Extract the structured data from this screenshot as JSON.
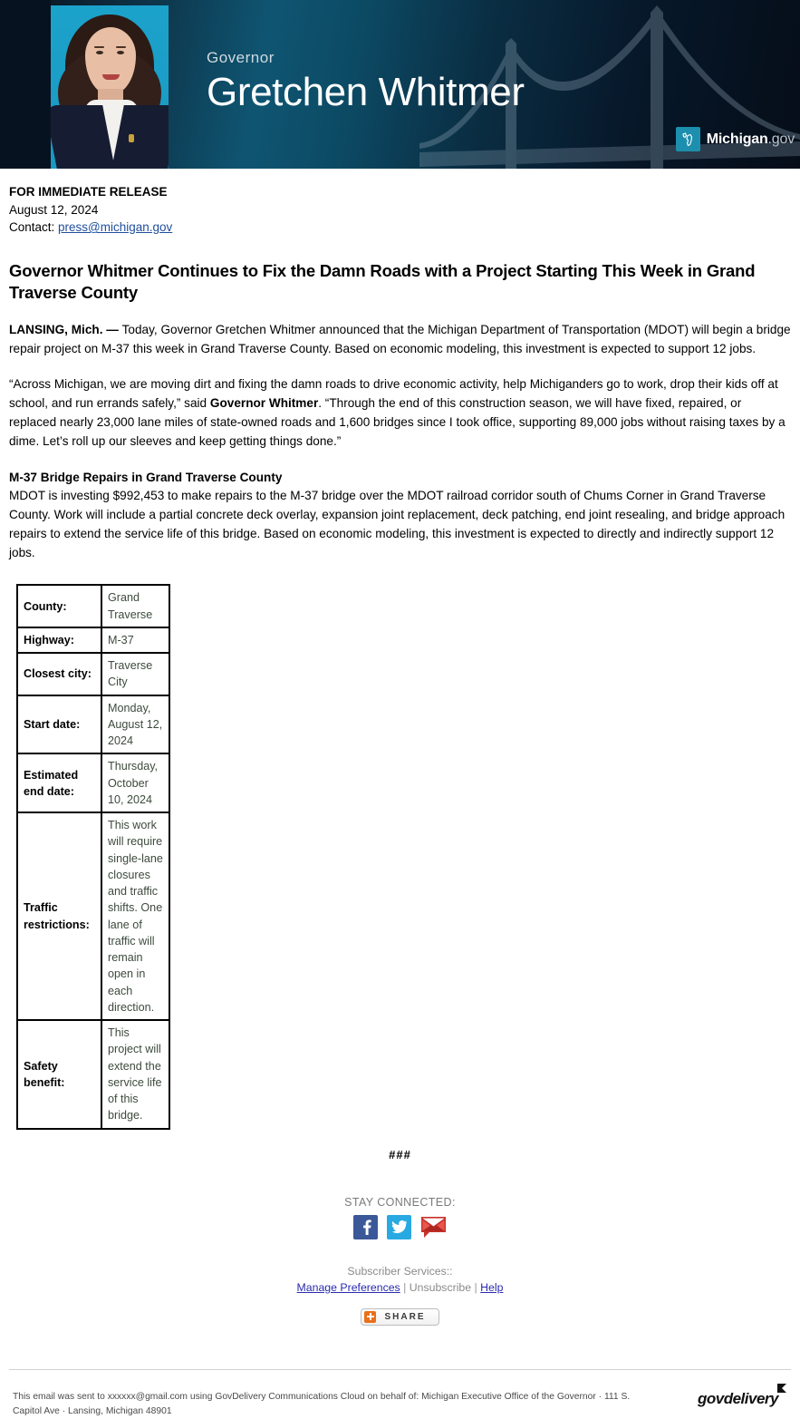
{
  "banner": {
    "gov_label": "Governor",
    "gov_name": "Gretchen Whitmer",
    "logo_word": "Michigan",
    "logo_suffix": ".gov",
    "portrait_alt": "governor-portrait",
    "gradient_start": "#0f5572",
    "gradient_end": "#050d18",
    "badge_color": "#1d8fae"
  },
  "release": {
    "label": "FOR IMMEDIATE RELEASE",
    "date": "August 12, 2024",
    "contact_prefix": "Contact: ",
    "contact_email": "press@michigan.gov"
  },
  "headline": "Governor Whitmer Continues to Fix the Damn Roads with a Project Starting This Week in Grand Traverse County",
  "paragraphs": {
    "lede_dateline": "LANSING, Mich. — ",
    "lede_body": " Today, Governor Gretchen Whitmer announced that the Michigan Department of Transportation (MDOT) will begin a bridge repair project on M-37 this week in Grand Traverse County. Based on economic modeling, this investment is expected to support 12 jobs.",
    "quote_part1": "“Across Michigan, we are moving dirt and fixing the damn roads to drive economic activity, help Michiganders go to work, drop their kids off at school, and run errands safely,” said ",
    "quote_attrib": "Governor Whitmer",
    "quote_part2": ". “Through the end of this construction season, we will have fixed, repaired, or replaced nearly 23,000 lane miles of state-owned roads and 1,600 bridges since I took office, supporting 89,000 jobs without raising taxes by a dime. Let’s roll up our sleeves and keep getting things done.”",
    "section_heading": "M-37 Bridge Repairs in Grand Traverse County",
    "section_body": "MDOT is investing $992,453 to make repairs to the M-37 bridge over the MDOT railroad corridor south of Chums Corner in Grand Traverse County. Work will include a partial concrete deck overlay, expansion joint replacement, deck patching, end joint resealing, and bridge approach repairs to extend the service life of this bridge. Based on economic modeling, this investment is expected to directly and indirectly support 12 jobs."
  },
  "project_table": {
    "rows": [
      {
        "key": "County:",
        "value": "Grand Traverse"
      },
      {
        "key": "Highway:",
        "value": "M-37"
      },
      {
        "key": "Closest city:",
        "value": "Traverse City"
      },
      {
        "key": "Start date:",
        "value": "Monday, August 12, 2024"
      },
      {
        "key": "Estimated end date:",
        "value": "Thursday, October 10, 2024"
      },
      {
        "key": "Traffic restrictions:",
        "value": "This work will require single-lane closures and traffic shifts. One lane of traffic will remain open in each direction."
      },
      {
        "key": "Safety benefit:",
        "value": "This project will extend the service life of this bridge."
      }
    ]
  },
  "footer": {
    "end_marker": "###",
    "stay_connected": "STAY CONNECTED:",
    "social": [
      {
        "name": "facebook",
        "label": "f",
        "color": "#3b5998"
      },
      {
        "name": "twitter",
        "label": "t",
        "color": "#29a9e1"
      },
      {
        "name": "email",
        "label": "mail",
        "color": "#c8322b"
      }
    ],
    "subscriber_label": "Subscriber Services::",
    "manage_preferences": "Manage Preferences",
    "separator": "|",
    "unsubscribe": "Unsubscribe",
    "help": "Help",
    "share_label": "SHARE"
  },
  "legal": {
    "text": "This email was sent to xxxxxx@gmail.com using GovDelivery Communications Cloud on behalf of: Michigan Executive Office of the Governor · 111 S. Capitol Ave · Lansing, Michigan 48901",
    "brand": "govdelivery"
  }
}
